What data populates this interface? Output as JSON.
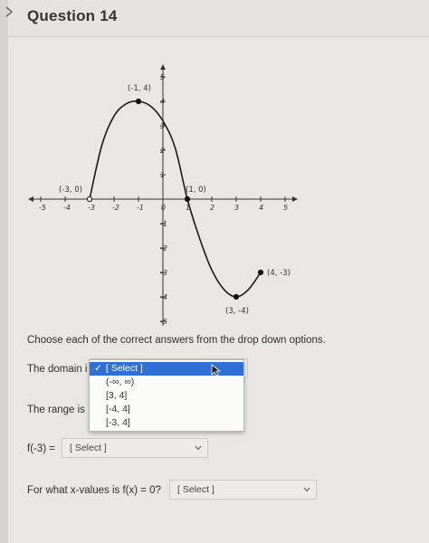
{
  "question": {
    "title": "Question 14"
  },
  "chart_data": {
    "type": "line",
    "x_ticks": [
      "-5",
      "-4",
      "-3",
      "-2",
      "-1",
      "0",
      "1",
      "2",
      "3",
      "4",
      "5"
    ],
    "y_ticks": [
      "5",
      "4",
      "3",
      "2",
      "1",
      "0",
      "-1",
      "-2",
      "-3",
      "-4",
      "-5"
    ],
    "xlim": [
      -5,
      5
    ],
    "ylim": [
      -5,
      5
    ],
    "grid": false,
    "series": [
      {
        "x": [
          -3,
          -2.5,
          -2,
          -1.5,
          -1,
          -0.5,
          0,
          0.5,
          1,
          1.5,
          2,
          2.5,
          3,
          3.5,
          4
        ],
        "y": [
          0,
          2.2,
          3.4,
          3.9,
          4,
          3.8,
          3.2,
          2.1,
          0,
          -1.6,
          -2.9,
          -3.7,
          -4,
          -3.7,
          -3
        ]
      }
    ],
    "points": [
      {
        "label": "(-3, 0)",
        "x": -3,
        "y": 0,
        "filled": false
      },
      {
        "label": "(-1, 4)",
        "x": -1,
        "y": 4,
        "filled": true
      },
      {
        "label": "(1, 0)",
        "x": 1,
        "y": 0,
        "filled": true
      },
      {
        "label": "(3, -4)",
        "x": 3,
        "y": -4,
        "filled": true
      },
      {
        "label": "(4, -3)",
        "x": 4,
        "y": -3,
        "filled": true
      }
    ]
  },
  "instructions": "Choose each of the correct answers from the drop down options.",
  "domain_question": {
    "label": "The domain i"
  },
  "range_question": {
    "label": "The range is"
  },
  "dropdown": {
    "options": [
      "[ Select ]",
      "(-∞, ∞)",
      "[3, 4]",
      "[-4, 4]",
      "[-3, 4]"
    ],
    "selected_index": 0,
    "check": "✓"
  },
  "f_question": {
    "label": "f(-3) =",
    "value": "[ Select ]"
  },
  "zeros_question": {
    "label": "For what x-values is f(x) = 0?",
    "value": "[ Select ]"
  }
}
